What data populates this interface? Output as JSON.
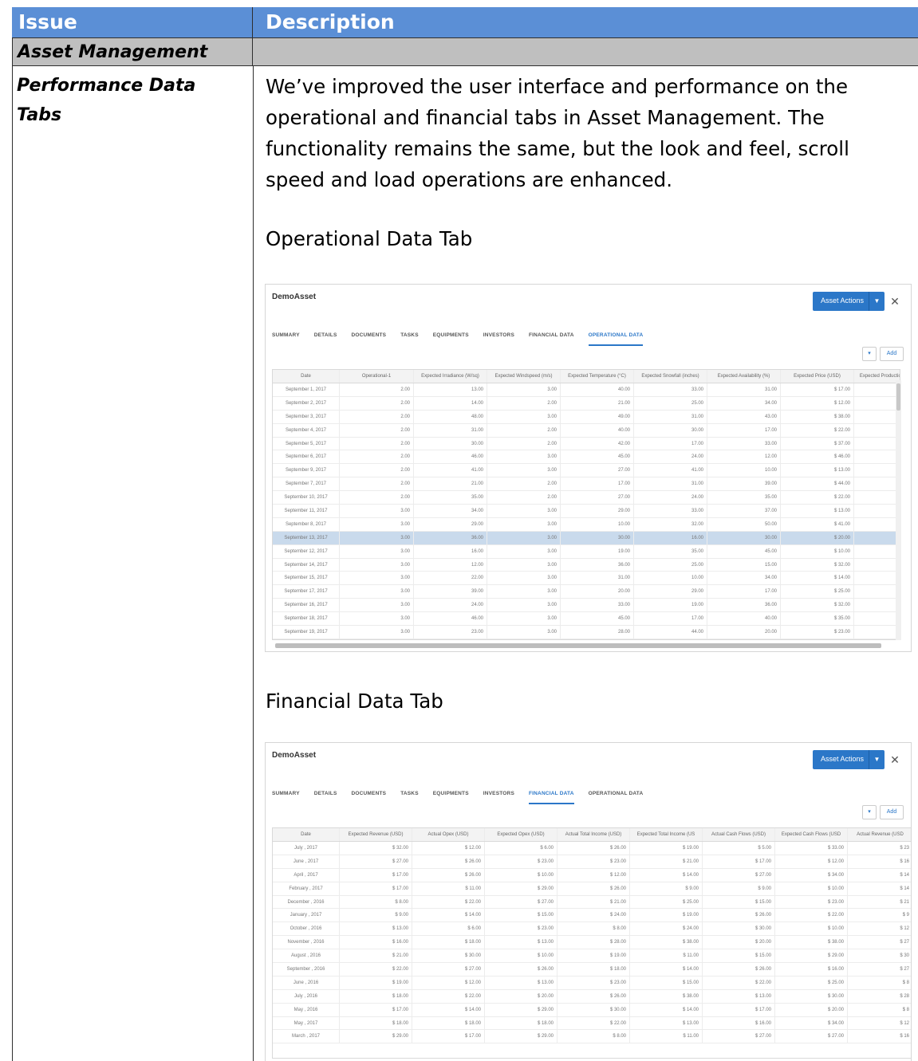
{
  "table": {
    "header_issue": "Issue",
    "header_description": "Description",
    "section": "Asset Management",
    "issue_title_line1": "Performance Data",
    "issue_title_line2": "Tabs",
    "description": "We’ve improved the user interface and performance on the operational and financial tabs in Asset Management.  The functionality remains the same, but the look and feel, scroll speed and load operations are enhanced.",
    "operational_heading": "Operational Data Tab",
    "financial_heading": "Financial Data Tab"
  },
  "operational": {
    "title": "DemoAsset",
    "actions_label": "Asset Actions",
    "close_label": "✕",
    "dropdown_label": "▾",
    "add_label": "Add",
    "tabs": [
      "SUMMARY",
      "DETAILS",
      "DOCUMENTS",
      "TASKS",
      "EQUIPMENTS",
      "INVESTORS",
      "FINANCIAL DATA",
      "OPERATIONAL DATA"
    ],
    "active_tab": 7,
    "columns": [
      "Date",
      "Operational-1",
      "Expected Irradiance (W/sq)",
      "Expected Windspeed (m/s)",
      "Expected Temperature (°C)",
      "Expected Snowfall (inches)",
      "Expected Availability (%)",
      "Expected Price (USD)",
      "Expected Production"
    ],
    "selected_row": 11,
    "rows": [
      [
        "September 1, 2017",
        "2.00",
        "13.00",
        "3.00",
        "40.00",
        "33.00",
        "31.00",
        "$ 17.00",
        ""
      ],
      [
        "September 2, 2017",
        "2.00",
        "14.00",
        "2.00",
        "21.00",
        "25.00",
        "34.00",
        "$ 12.00",
        ""
      ],
      [
        "September 3, 2017",
        "2.00",
        "48.00",
        "3.00",
        "49.00",
        "31.00",
        "43.00",
        "$ 38.00",
        ""
      ],
      [
        "September 4, 2017",
        "2.00",
        "31.00",
        "2.00",
        "40.00",
        "30.00",
        "17.00",
        "$ 22.00",
        ""
      ],
      [
        "September 5, 2017",
        "2.00",
        "30.00",
        "2.00",
        "42.00",
        "17.00",
        "33.00",
        "$ 37.00",
        ""
      ],
      [
        "September 6, 2017",
        "2.00",
        "46.00",
        "3.00",
        "45.00",
        "24.00",
        "12.00",
        "$ 46.00",
        ""
      ],
      [
        "September 9, 2017",
        "2.00",
        "41.00",
        "3.00",
        "27.00",
        "41.00",
        "10.00",
        "$ 13.00",
        ""
      ],
      [
        "September 7, 2017",
        "2.00",
        "21.00",
        "2.00",
        "17.00",
        "31.00",
        "39.00",
        "$ 44.00",
        ""
      ],
      [
        "September 10, 2017",
        "2.00",
        "35.00",
        "2.00",
        "27.00",
        "24.00",
        "35.00",
        "$ 22.00",
        ""
      ],
      [
        "September 11, 2017",
        "3.00",
        "34.00",
        "3.00",
        "29.00",
        "33.00",
        "37.00",
        "$ 13.00",
        ""
      ],
      [
        "September 8, 2017",
        "3.00",
        "29.00",
        "3.00",
        "10.00",
        "32.00",
        "50.00",
        "$ 41.00",
        ""
      ],
      [
        "September 13, 2017",
        "3.00",
        "36.00",
        "3.00",
        "30.00",
        "16.00",
        "30.00",
        "$ 20.00",
        ""
      ],
      [
        "September 12, 2017",
        "3.00",
        "16.00",
        "3.00",
        "19.00",
        "35.00",
        "45.00",
        "$ 10.00",
        ""
      ],
      [
        "September 14, 2017",
        "3.00",
        "12.00",
        "3.00",
        "36.00",
        "25.00",
        "15.00",
        "$ 32.00",
        ""
      ],
      [
        "September 15, 2017",
        "3.00",
        "22.00",
        "3.00",
        "31.00",
        "10.00",
        "34.00",
        "$ 14.00",
        ""
      ],
      [
        "September 17, 2017",
        "3.00",
        "39.00",
        "3.00",
        "20.00",
        "29.00",
        "17.00",
        "$ 25.00",
        ""
      ],
      [
        "September 16, 2017",
        "3.00",
        "24.00",
        "3.00",
        "33.00",
        "19.00",
        "36.00",
        "$ 32.00",
        ""
      ],
      [
        "September 18, 2017",
        "3.00",
        "46.00",
        "3.00",
        "45.00",
        "17.00",
        "40.00",
        "$ 35.00",
        ""
      ],
      [
        "September 19, 2017",
        "3.00",
        "23.00",
        "3.00",
        "28.00",
        "44.00",
        "20.00",
        "$ 23.00",
        ""
      ]
    ]
  },
  "financial": {
    "title": "DemoAsset",
    "actions_label": "Asset Actions",
    "close_label": "✕",
    "dropdown_label": "▾",
    "add_label": "Add",
    "tabs": [
      "SUMMARY",
      "DETAILS",
      "DOCUMENTS",
      "TASKS",
      "EQUIPMENTS",
      "INVESTORS",
      "FINANCIAL DATA",
      "OPERATIONAL DATA"
    ],
    "active_tab": 6,
    "columns": [
      "Date",
      "Expected Revenue (USD)",
      "Actual Opex (USD)",
      "Expected Opex (USD)",
      "Actual Total Income (USD)",
      "Expected Total Income (US",
      "Actual Cash Flows (USD)",
      "Expected Cash Flows (USD",
      "Actual Revenue (USD"
    ],
    "selected_row": -1,
    "rows": [
      [
        "July , 2017",
        "$ 32.00",
        "$ 12.00",
        "$ 6.00",
        "$ 26.00",
        "$ 19.00",
        "$ 5.00",
        "$ 33.00",
        "$ 23"
      ],
      [
        "June , 2017",
        "$ 27.00",
        "$ 26.00",
        "$ 23.00",
        "$ 23.00",
        "$ 21.00",
        "$ 17.00",
        "$ 12.00",
        "$ 16"
      ],
      [
        "April , 2017",
        "$ 17.00",
        "$ 26.00",
        "$ 10.00",
        "$ 12.00",
        "$ 14.00",
        "$ 27.00",
        "$ 34.00",
        "$ 14"
      ],
      [
        "February , 2017",
        "$ 17.00",
        "$ 11.00",
        "$ 29.00",
        "$ 26.00",
        "$ 9.00",
        "$ 9.00",
        "$ 10.00",
        "$ 14"
      ],
      [
        "December , 2016",
        "$ 8.00",
        "$ 22.00",
        "$ 27.00",
        "$ 21.00",
        "$ 25.00",
        "$ 15.00",
        "$ 23.00",
        "$ 21"
      ],
      [
        "January , 2017",
        "$ 9.00",
        "$ 14.00",
        "$ 15.00",
        "$ 24.00",
        "$ 19.00",
        "$ 26.00",
        "$ 22.00",
        "$ 9"
      ],
      [
        "October , 2016",
        "$ 13.00",
        "$ 6.00",
        "$ 23.00",
        "$ 8.00",
        "$ 24.00",
        "$ 30.00",
        "$ 10.00",
        "$ 12"
      ],
      [
        "November , 2016",
        "$ 16.00",
        "$ 18.00",
        "$ 13.00",
        "$ 28.00",
        "$ 38.00",
        "$ 20.00",
        "$ 38.00",
        "$ 27"
      ],
      [
        "August , 2016",
        "$ 21.00",
        "$ 30.00",
        "$ 10.00",
        "$ 19.00",
        "$ 11.00",
        "$ 15.00",
        "$ 29.00",
        "$ 30"
      ],
      [
        "September , 2016",
        "$ 22.00",
        "$ 27.00",
        "$ 26.00",
        "$ 18.00",
        "$ 14.00",
        "$ 26.00",
        "$ 16.00",
        "$ 27"
      ],
      [
        "June , 2016",
        "$ 19.00",
        "$ 12.00",
        "$ 13.00",
        "$ 23.00",
        "$ 15.00",
        "$ 22.00",
        "$ 25.00",
        "$ 8"
      ],
      [
        "July , 2016",
        "$ 18.00",
        "$ 22.00",
        "$ 20.00",
        "$ 26.00",
        "$ 38.00",
        "$ 13.00",
        "$ 30.00",
        "$ 28"
      ],
      [
        "May , 2016",
        "$ 17.00",
        "$ 14.00",
        "$ 29.00",
        "$ 30.00",
        "$ 14.00",
        "$ 17.00",
        "$ 20.00",
        "$ 8"
      ],
      [
        "May , 2017",
        "$ 18.00",
        "$ 18.00",
        "$ 18.00",
        "$ 22.00",
        "$ 13.00",
        "$ 16.00",
        "$ 34.00",
        "$ 12"
      ],
      [
        "March , 2017",
        "$ 29.00",
        "$ 17.00",
        "$ 29.00",
        "$ 8.00",
        "$ 11.00",
        "$ 27.00",
        "$ 27.00",
        "$ 16"
      ]
    ]
  }
}
